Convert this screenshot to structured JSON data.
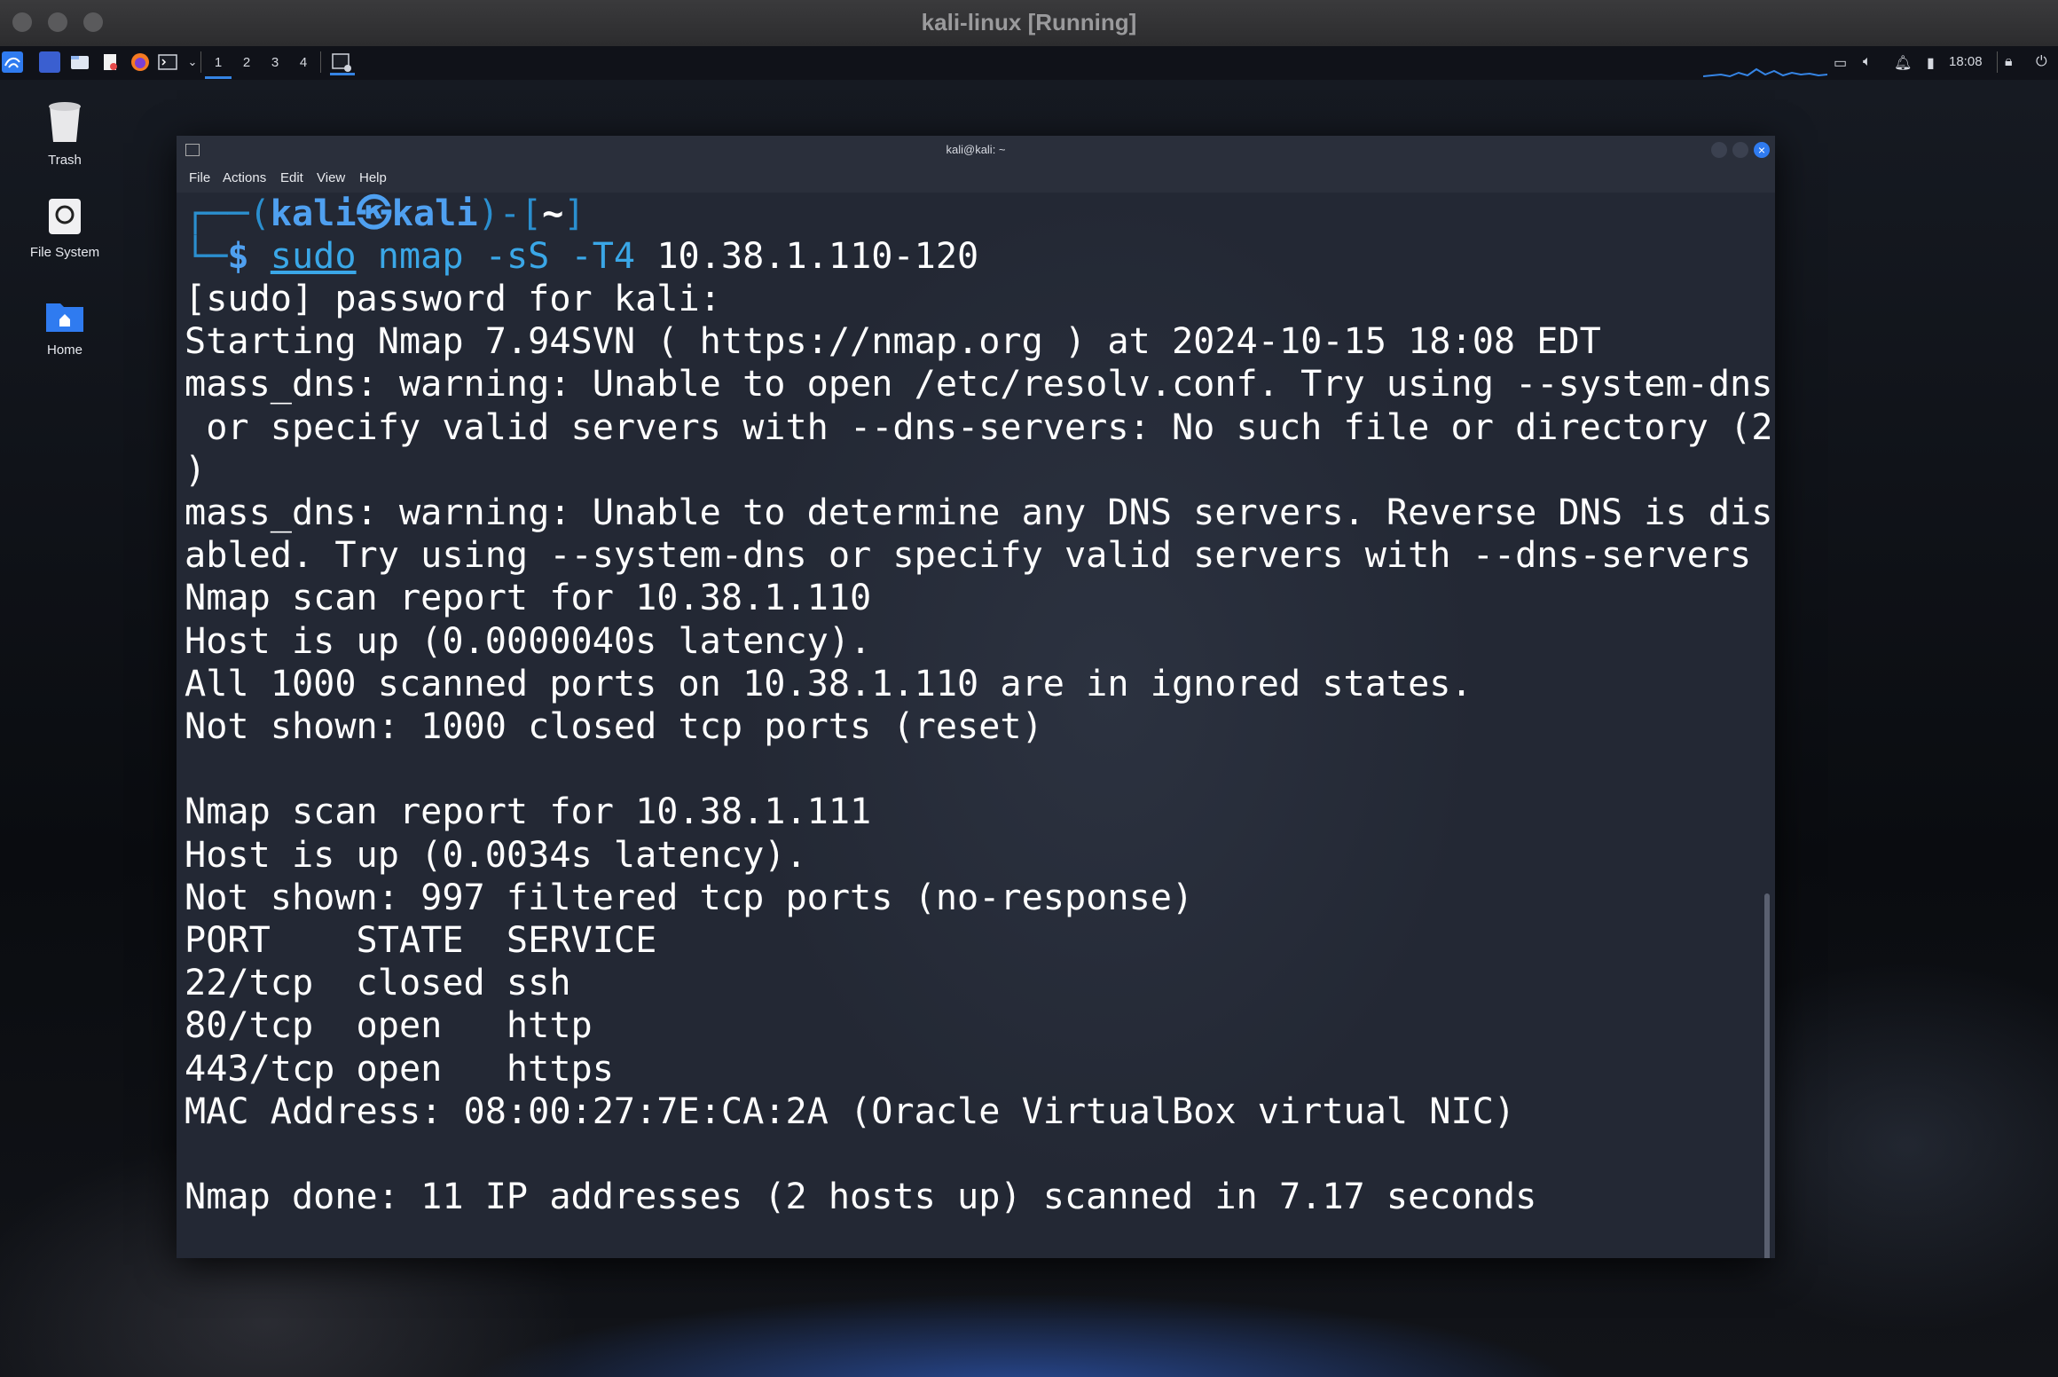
{
  "host_window": {
    "title": "kali-linux [Running]"
  },
  "panel": {
    "workspaces": [
      "1",
      "2",
      "3",
      "4"
    ],
    "active_workspace": "1",
    "clock": "18:08",
    "icons": [
      "kali-menu-icon",
      "desktop-icon",
      "file-manager-icon",
      "text-editor-icon",
      "firefox-icon",
      "terminal-icon",
      "dropdown-chevron-icon",
      "terminal-task-icon",
      "display-icon",
      "volume-icon",
      "notification-icon",
      "battery-icon",
      "lock-icon",
      "power-icon"
    ]
  },
  "desktop": {
    "icons": [
      {
        "label": "Trash",
        "icon": "trash-icon"
      },
      {
        "label": "File System",
        "icon": "drive-icon"
      },
      {
        "label": "Home",
        "icon": "home-folder-icon"
      }
    ]
  },
  "terminal": {
    "title": "kali@kali: ~",
    "menu": [
      "File",
      "Actions",
      "Edit",
      "View",
      "Help"
    ],
    "prompt": {
      "corner_top": "┌──(",
      "user": "kali",
      "at_symbol": "㉿",
      "host": "kali",
      "mid": ")-[",
      "dir": "~",
      "end": "]",
      "corner_bottom": "└─",
      "dollar": "$"
    },
    "command": {
      "sudo": "sudo",
      "rest": " nmap -sS -T4",
      "target": " 10.38.1.110-120"
    },
    "output": [
      "[sudo] password for kali:",
      "Starting Nmap 7.94SVN ( https://nmap.org ) at 2024-10-15 18:08 EDT",
      "mass_dns: warning: Unable to open /etc/resolv.conf. Try using --system-dns",
      " or specify valid servers with --dns-servers: No such file or directory (2",
      ")",
      "mass_dns: warning: Unable to determine any DNS servers. Reverse DNS is dis",
      "abled. Try using --system-dns or specify valid servers with --dns-servers",
      "Nmap scan report for 10.38.1.110",
      "Host is up (0.0000040s latency).",
      "All 1000 scanned ports on 10.38.1.110 are in ignored states.",
      "Not shown: 1000 closed tcp ports (reset)",
      "",
      "Nmap scan report for 10.38.1.111",
      "Host is up (0.0034s latency).",
      "Not shown: 997 filtered tcp ports (no-response)",
      "PORT    STATE  SERVICE",
      "22/tcp  closed ssh",
      "80/tcp  open   http",
      "443/tcp open   https",
      "MAC Address: 08:00:27:7E:CA:2A (Oracle VirtualBox virtual NIC)",
      "",
      "Nmap done: 11 IP addresses (2 hosts up) scanned in 7.17 seconds"
    ]
  }
}
